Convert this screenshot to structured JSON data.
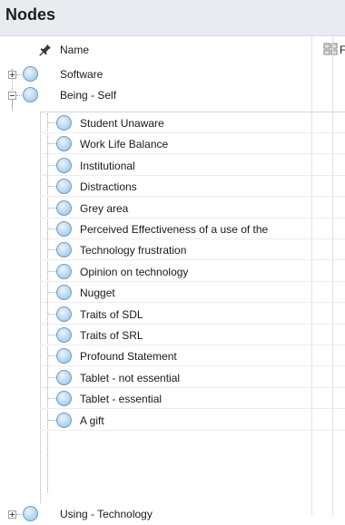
{
  "panel": {
    "title": "Nodes"
  },
  "columns": {
    "name": "Name",
    "files_partial": "F"
  },
  "top_nodes": [
    {
      "label": "Software",
      "expander": "plus"
    },
    {
      "label": "Being - Self",
      "expander": "minus"
    }
  ],
  "children": [
    {
      "label": "Student Unaware"
    },
    {
      "label": "Work Life Balance"
    },
    {
      "label": "Institutional"
    },
    {
      "label": "Distractions"
    },
    {
      "label": "Grey area"
    },
    {
      "label": "Perceived Effectiveness of a use of the"
    },
    {
      "label": "Technology frustration"
    },
    {
      "label": "Opinion on technology"
    },
    {
      "label": "Nugget"
    },
    {
      "label": "Traits of SDL"
    },
    {
      "label": "Traits of SRL"
    },
    {
      "label": "Profound Statement"
    },
    {
      "label": "Tablet - not essential"
    },
    {
      "label": "Tablet - essential"
    },
    {
      "label": "A gift"
    }
  ],
  "bottom_node": {
    "label": "Using - Technology",
    "expander": "plus"
  },
  "colors": {
    "header_bg": "#e8ebef",
    "node_fill": "#b9d8ef",
    "node_border": "#6f9ec6"
  },
  "icons": {
    "pin": "pushpin-icon",
    "files": "files-icon",
    "node": "node-circle-icon"
  }
}
